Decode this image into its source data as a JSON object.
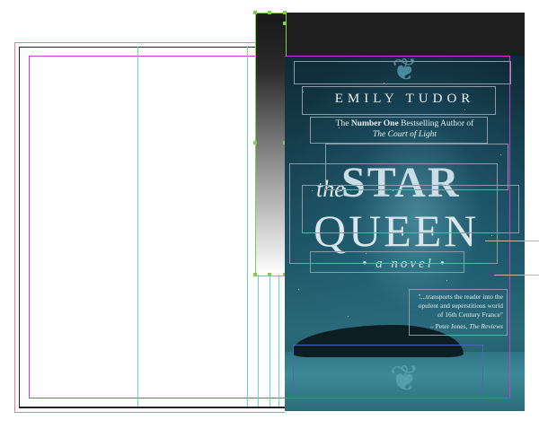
{
  "cover": {
    "author": "EMILY TUDOR",
    "tagline_prefix": "The ",
    "tagline_bold": "Number One",
    "tagline_suffix": " Bestselling Author of",
    "tagline_book": "The Court of Light",
    "title_the": "the",
    "title_star": "STAR",
    "title_queen": "QUEEN",
    "subtitle": "• a novel •",
    "quote_line1": "\"...transports the reader into the",
    "quote_line2": "opulent and superstitious world",
    "quote_line3": "of 16th Century France\"",
    "quote_attrib_prefix": "– Peter Jones, ",
    "quote_attrib_source": "The Reviews"
  },
  "colors": {
    "guide": "#5fd3e0",
    "margin": "#c040c8",
    "bleed": "#e87a9a",
    "selection": "#7ed04b"
  }
}
